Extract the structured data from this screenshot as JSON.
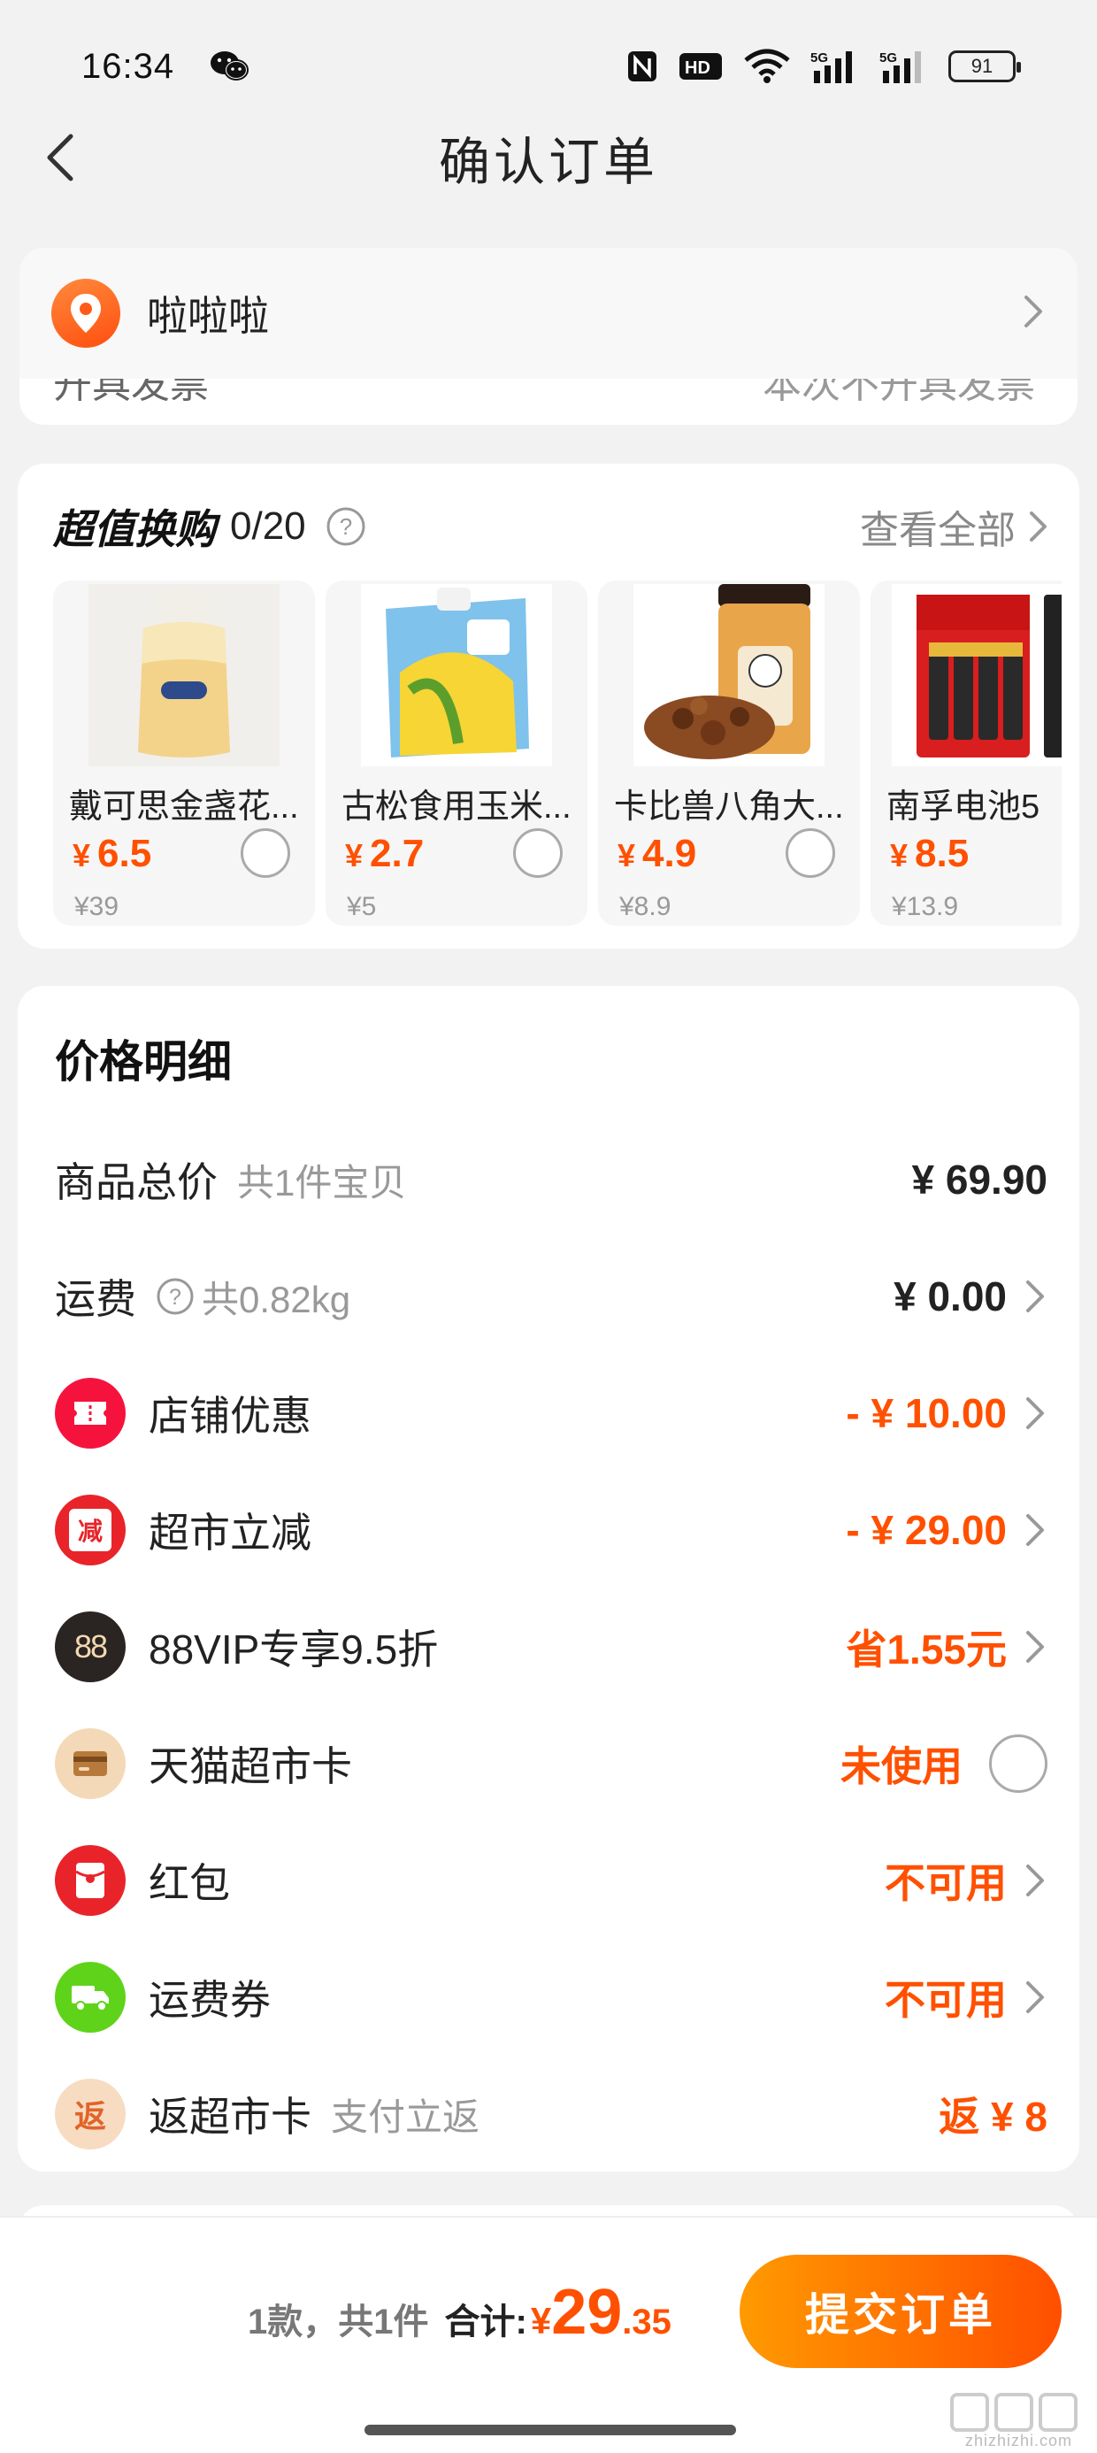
{
  "status_bar": {
    "time": "16:34",
    "battery": "91"
  },
  "header": {
    "title": "确认订单"
  },
  "address": {
    "name": "啦啦啦"
  },
  "invoice": {
    "label": "开具发票",
    "value": "本次不开具发票"
  },
  "swap": {
    "title": "超值换购",
    "count": "0/20",
    "view_all": "查看全部",
    "items": [
      {
        "name": "戴可思金盏花...",
        "price": "6.5",
        "original": "¥39"
      },
      {
        "name": "古松食用玉米...",
        "price": "2.7",
        "original": "¥5"
      },
      {
        "name": "卡比兽八角大...",
        "price": "4.9",
        "original": "¥8.9"
      },
      {
        "name": "南孚电池5",
        "price": "8.5",
        "original": "¥13.9"
      }
    ]
  },
  "currency": "¥",
  "price_detail": {
    "title": "价格明细",
    "total": {
      "label": "商品总价",
      "sub": "共1件宝贝",
      "value": "¥ 69.90"
    },
    "shipping": {
      "label": "运费",
      "sub": "共0.82kg",
      "value": "¥ 0.00"
    },
    "shop_discount": {
      "label": "店铺优惠",
      "value": "- ¥ 10.00",
      "icon_color": "#f5133d"
    },
    "market_discount": {
      "label": "超市立减",
      "value": "- ¥ 29.00",
      "icon_color": "#e8242a",
      "icon_text": "减"
    },
    "vip": {
      "label": "88VIP专享9.5折",
      "value": "省1.55元",
      "icon_text": "88",
      "icon_color": "#2a2422"
    },
    "card": {
      "label": "天猫超市卡",
      "value": "未使用",
      "icon_color": "#f3d9b8"
    },
    "red_packet": {
      "label": "红包",
      "value": "不可用",
      "icon_color": "#e8242a"
    },
    "shipping_coupon": {
      "label": "运费券",
      "value": "不可用",
      "icon_color": "#5fd319"
    },
    "cashback": {
      "label": "返超市卡",
      "sub": "支付立返",
      "value": "返 ¥ 8",
      "icon_text": "返",
      "icon_color": "#f7dcc2"
    }
  },
  "footer": {
    "count": "1款，共1件",
    "total_label": "合计:",
    "total_currency": "¥",
    "total_int": "29",
    "total_dec": ".35",
    "submit": "提交订单"
  },
  "watermark": {
    "text": "zhizhizhi.com"
  },
  "colors": {
    "accent": "#ff5000",
    "button_start": "#ff9a00",
    "button_end": "#ff4f00"
  }
}
